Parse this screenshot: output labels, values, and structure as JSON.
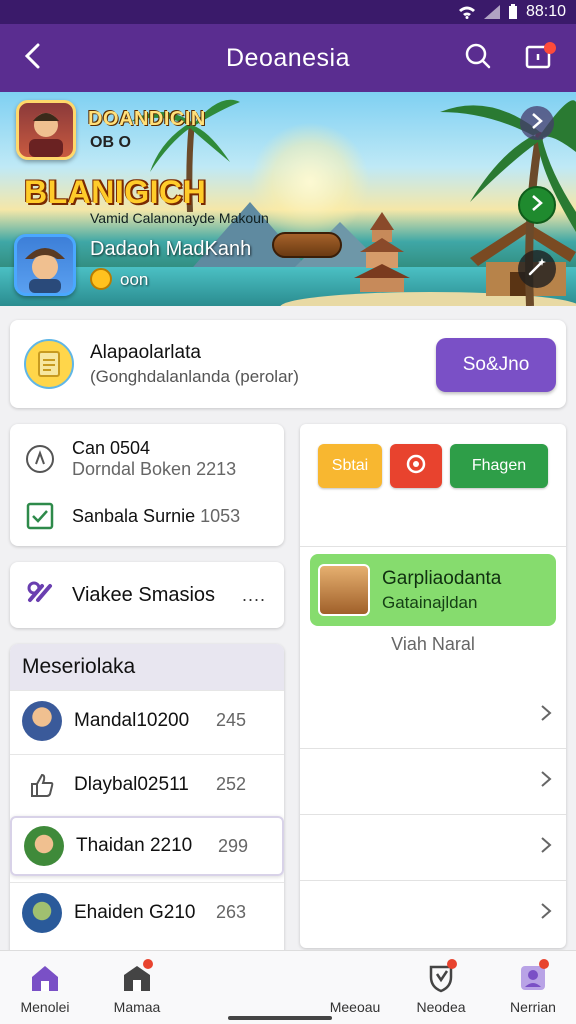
{
  "status_bar": {
    "time": "88:10"
  },
  "app_bar": {
    "title": "Deoanesia"
  },
  "hero": {
    "player1_name": "DOANDICIN",
    "player1_score": "OB O",
    "brand": "BLANIGICH",
    "tagline": "Vamid Calanonayde Makoun",
    "player2_name": "Dadaoh MadKanh",
    "player2_score": "oon"
  },
  "promo": {
    "title": "Alapaolarlata",
    "subtitle": "(Gonghdalanlanda (perolar)",
    "cta_label": "So&Jno"
  },
  "stats": [
    {
      "label": "Can 0504",
      "sub": "Dorndal Boken 2213"
    },
    {
      "label": "Sanbala Surnie",
      "sub": "1053"
    }
  ],
  "session": {
    "label": "Viakee Smasios",
    "more": "...."
  },
  "ranking": {
    "header": "Meseriolaka",
    "rows": [
      {
        "name": "Mandal10200",
        "score": "245"
      },
      {
        "name": "Dlaybal02511",
        "score": "252"
      },
      {
        "name": "Thaidan 2210",
        "score": "299"
      },
      {
        "name": "Ehaiden G210",
        "score": "263"
      }
    ]
  },
  "chips": [
    "Sbtai",
    "",
    "Fhagen"
  ],
  "feature": {
    "title": "Garpliaodanta",
    "subtitle": "Gatainajldan"
  },
  "right_label": "Viah Naral",
  "bottom_nav": [
    {
      "label": "Menolei"
    },
    {
      "label": "Mamaa"
    },
    {
      "label": "Meeoau"
    },
    {
      "label": "Neodea"
    },
    {
      "label": "Nerrian"
    }
  ],
  "colors": {
    "primary": "#5a2d90",
    "accent": "#7a50c6",
    "green": "#2e9e48",
    "orange": "#f8b730",
    "red": "#e8432e"
  }
}
